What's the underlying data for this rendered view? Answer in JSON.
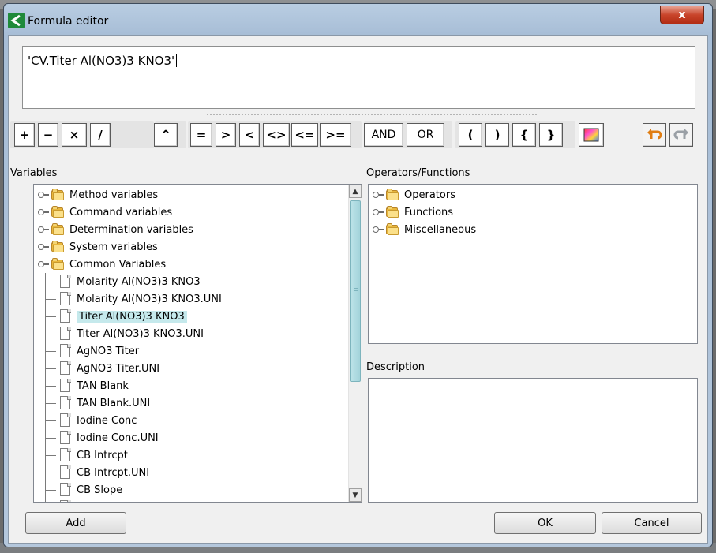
{
  "window": {
    "title": "Formula editor",
    "close_glyph": "x"
  },
  "formula": {
    "value": "'CV.Titer Al(NO3)3 KNO3'"
  },
  "toolbar": {
    "arithmetic": [
      "+",
      "−",
      "×",
      "/"
    ],
    "power": "^",
    "comparison": [
      "=",
      ">",
      "<",
      "<>",
      "<=",
      ">="
    ],
    "logic": [
      "AND",
      "OR"
    ],
    "brackets": [
      "(",
      ")",
      "{",
      "}"
    ]
  },
  "variables": {
    "label": "Variables",
    "folders": [
      "Method variables",
      "Command variables",
      "Determination variables",
      "System variables",
      "Common Variables"
    ],
    "common_items": [
      "Molarity Al(NO3)3 KNO3",
      "Molarity Al(NO3)3 KNO3.UNI",
      "Titer Al(NO3)3 KNO3",
      "Titer Al(NO3)3 KNO3.UNI",
      "AgNO3 Titer",
      "AgNO3 Titer.UNI",
      "TAN Blank",
      "TAN Blank.UNI",
      "Iodine Conc",
      "Iodine Conc.UNI",
      "CB Intrcpt",
      "CB Intrcpt.UNI",
      "CB Slope"
    ],
    "selected_item": "Titer Al(NO3)3 KNO3"
  },
  "operators": {
    "label": "Operators/Functions",
    "folders": [
      "Operators",
      "Functions",
      "Miscellaneous"
    ]
  },
  "description": {
    "label": "Description",
    "value": ""
  },
  "buttons": {
    "add": "Add",
    "ok": "OK",
    "cancel": "Cancel"
  },
  "colors": {
    "selection": "#c5e9ec",
    "folder": "#e9b73b",
    "title_bar": "#b9cde2",
    "close_button": "#c8442a"
  }
}
